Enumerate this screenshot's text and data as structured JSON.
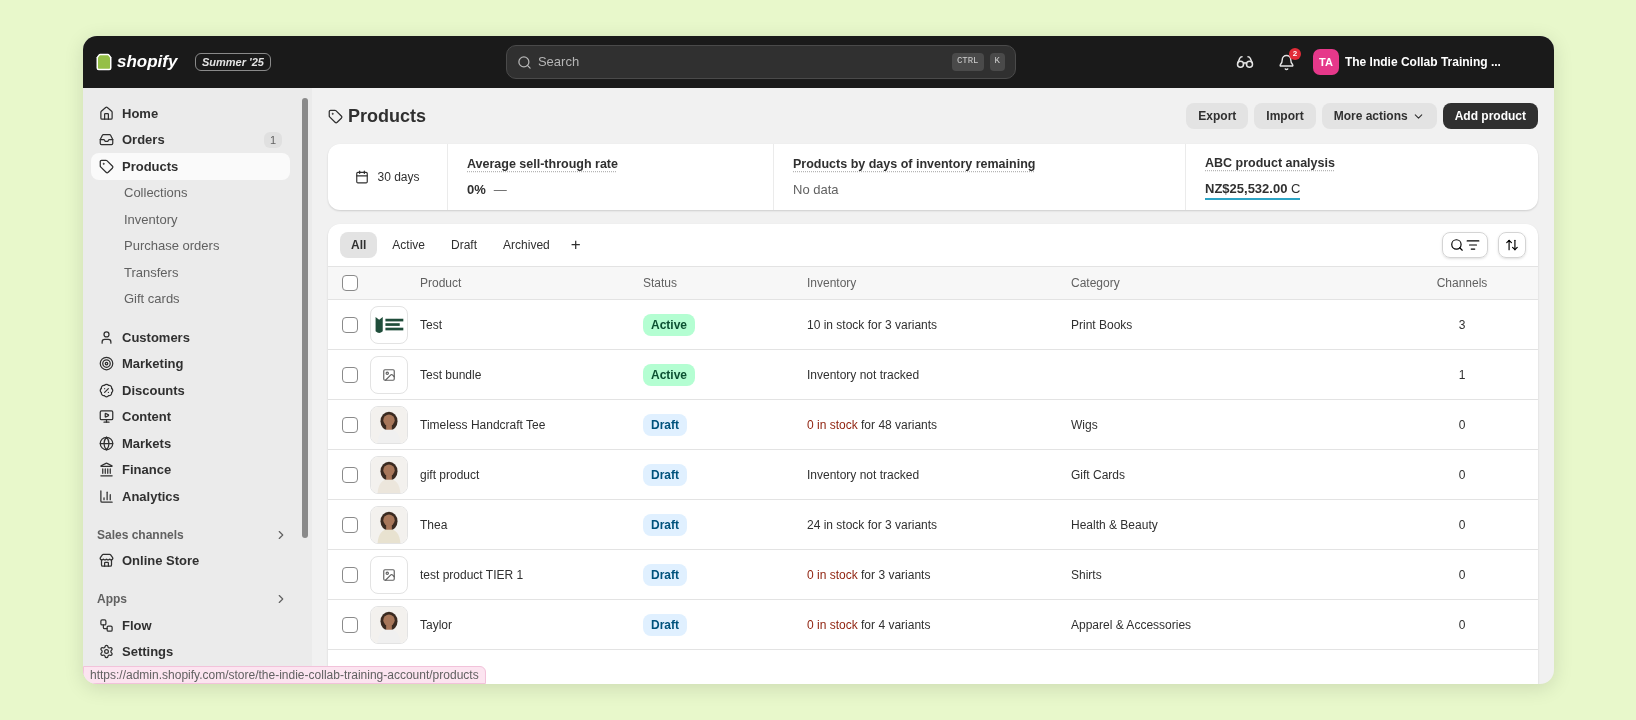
{
  "topbar": {
    "logo": "shopify",
    "edition": "Summer '25",
    "search": {
      "placeholder": "Search",
      "keys": [
        "CTRL",
        "K"
      ]
    },
    "notifications": "2",
    "avatar": "TA",
    "store": "The Indie Collab Training ..."
  },
  "sidebar": {
    "sections": [
      {
        "items": [
          {
            "label": "Home",
            "selected": false
          },
          {
            "label": "Orders",
            "badge": "1",
            "selected": false
          },
          {
            "label": "Products",
            "selected": true,
            "children": [
              {
                "label": "Collections",
                "selected": false
              },
              {
                "label": "Inventory",
                "selected": false
              },
              {
                "label": "Purchase orders",
                "selected": false
              },
              {
                "label": "Transfers",
                "selected": false
              },
              {
                "label": "Gift cards",
                "selected": false
              }
            ]
          }
        ]
      },
      {
        "items": [
          {
            "label": "Customers",
            "selected": false
          },
          {
            "label": "Marketing",
            "selected": false
          },
          {
            "label": "Discounts",
            "selected": false
          },
          {
            "label": "Content",
            "selected": false
          },
          {
            "label": "Markets",
            "selected": false
          },
          {
            "label": "Finance",
            "selected": false
          },
          {
            "label": "Analytics",
            "selected": false
          }
        ]
      },
      {
        "heading": "Sales channels",
        "items": [
          {
            "label": "Online Store",
            "selected": false
          }
        ]
      },
      {
        "heading": "Apps",
        "items": [
          {
            "label": "Flow",
            "selected": false
          },
          {
            "label": "Settings",
            "selected": false
          }
        ]
      }
    ]
  },
  "page": {
    "title": "Products",
    "actions": [
      "Export",
      "Import",
      "More actions"
    ],
    "primary_action": "Add product"
  },
  "stats": {
    "period": "30 days",
    "metrics": [
      {
        "title": "Average sell-through rate",
        "value": "0%",
        "trend": "—"
      },
      {
        "title": "Products by days of inventory remaining",
        "value": "No data",
        "muted": true
      },
      {
        "title": "ABC product analysis",
        "value": "NZ$25,532.00",
        "suffix": "C",
        "underlined": true
      }
    ]
  },
  "tabs": [
    {
      "label": "All",
      "selected": true
    },
    {
      "label": "Active",
      "selected": false
    },
    {
      "label": "Draft",
      "selected": false
    },
    {
      "label": "Archived",
      "selected": false
    }
  ],
  "add_tab": "+",
  "table": {
    "columns": [
      "Product",
      "Status",
      "Inventory",
      "Category",
      "Channels"
    ],
    "all_checked": false,
    "rows": [
      {
        "checked": false,
        "thumb": {
          "kind": "logo"
        },
        "product": "Test",
        "status": {
          "label": "Active",
          "kind": "active"
        },
        "inventory": {
          "stock": "10 in stock for 3 variants",
          "alert": false
        },
        "category": "Print Books",
        "channels": "3"
      },
      {
        "checked": false,
        "thumb": {
          "kind": "placeholder"
        },
        "product": "Test bundle",
        "status": {
          "label": "Active",
          "kind": "active"
        },
        "inventory": {
          "stock": "Inventory not tracked",
          "alert": false
        },
        "channels": "1"
      },
      {
        "checked": false,
        "product": "Timeless Handcraft Tee",
        "status": {
          "label": "Draft",
          "kind": "draft"
        },
        "inventory": {
          "stock": "0 in stock",
          "detail": "for 48 variants",
          "alert": true
        },
        "category": "Wigs",
        "channels": "0"
      },
      {
        "checked": false,
        "product": "gift product",
        "status": {
          "label": "Draft",
          "kind": "draft"
        },
        "inventory": {
          "stock": "Inventory not tracked",
          "alert": false
        },
        "category": "Gift Cards",
        "channels": "0"
      },
      {
        "checked": false,
        "product": "Thea",
        "status": {
          "label": "Draft",
          "kind": "draft"
        },
        "inventory": {
          "stock": "24 in stock for 3 variants",
          "alert": false
        },
        "category": "Health & Beauty",
        "channels": "0"
      },
      {
        "checked": false,
        "thumb": {
          "kind": "placeholder"
        },
        "product": "test product TIER 1",
        "status": {
          "label": "Draft",
          "kind": "draft"
        },
        "inventory": {
          "stock": "0 in stock",
          "detail": "for 3 variants",
          "alert": true
        },
        "category": "Shirts",
        "channels": "0"
      },
      {
        "checked": false,
        "product": "Taylor",
        "status": {
          "label": "Draft",
          "kind": "draft"
        },
        "inventory": {
          "stock": "0 in stock",
          "detail": "for 4 variants",
          "alert": true
        },
        "category": "Apparel & Accessories",
        "channels": "0"
      }
    ]
  },
  "status_url": "https://admin.shopify.com/store/the-indie-collab-training-account/products"
}
